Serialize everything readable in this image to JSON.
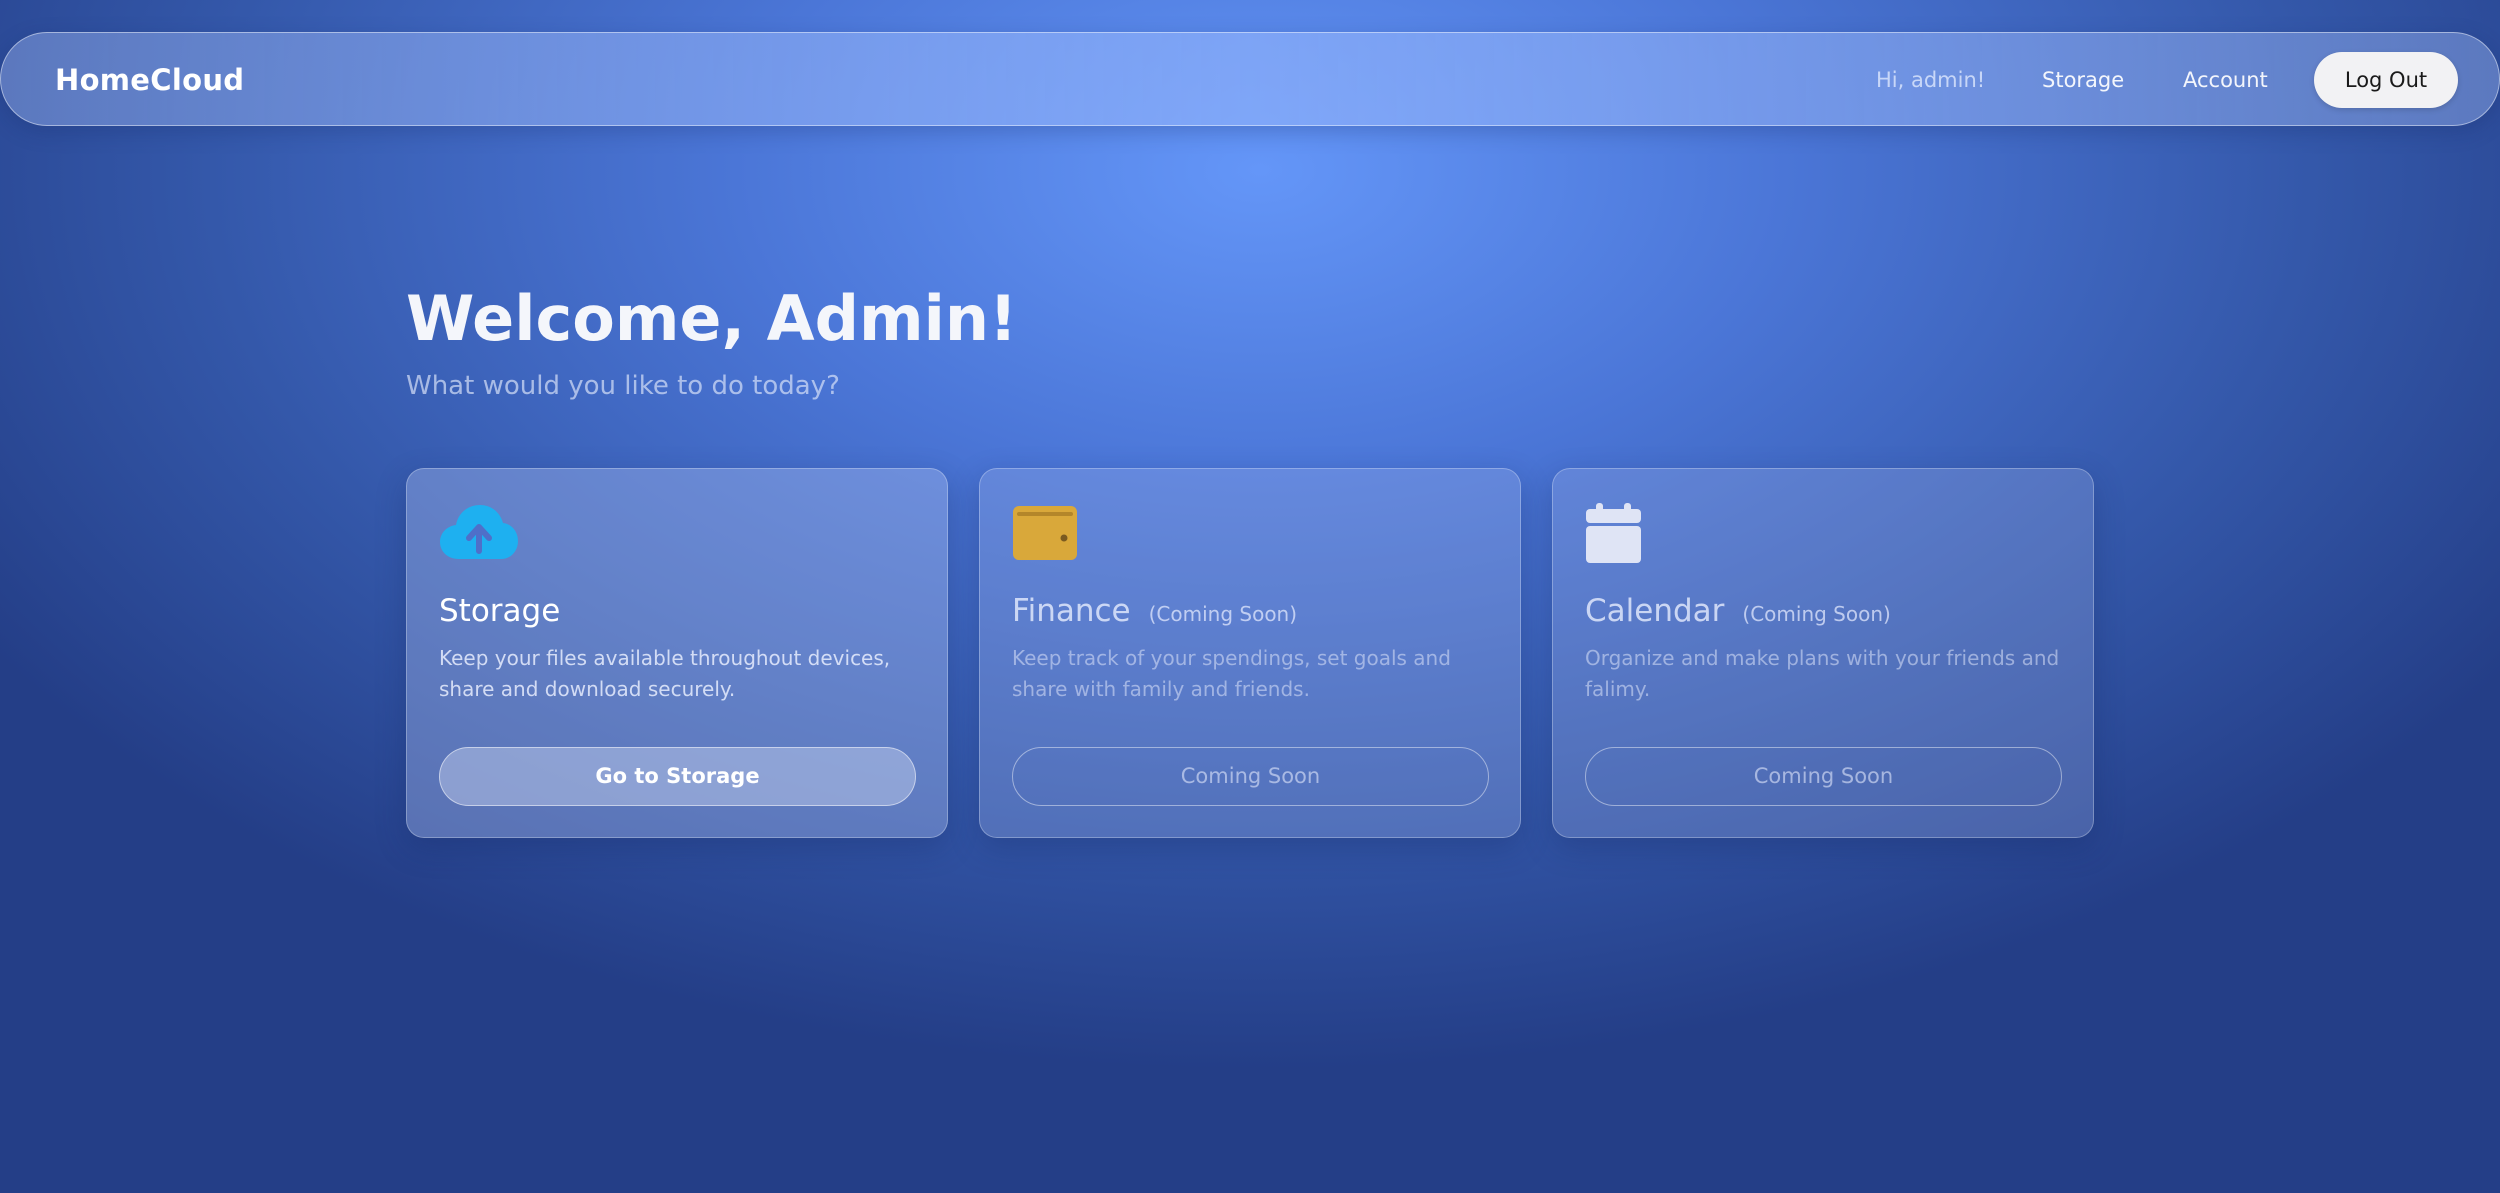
{
  "navbar": {
    "brand": "HomeCloud",
    "greeting": "Hi, admin!",
    "links": [
      {
        "label": "Storage"
      },
      {
        "label": "Account"
      }
    ],
    "logout_label": "Log Out"
  },
  "main": {
    "heading": "Welcome, Admin!",
    "subtitle": "What would you like to do today?"
  },
  "cards": [
    {
      "icon": "cloud-upload-icon",
      "icon_color": "#1eb0f0",
      "title": "Storage",
      "badge": "",
      "description": "Keep your files available throughout devices, share and download securely.",
      "button_label": "Go to Storage",
      "enabled": true
    },
    {
      "icon": "wallet-icon",
      "icon_color": "#d9a83a",
      "title": "Finance",
      "badge": "(Coming Soon)",
      "description": "Keep track of your spendings, set goals and share with family and friends.",
      "button_label": "Coming Soon",
      "enabled": false
    },
    {
      "icon": "calendar-icon",
      "icon_color": "#dfe4f5",
      "title": "Calendar",
      "badge": "(Coming Soon)",
      "description": "Organize and make plans with your friends and falimy.",
      "button_label": "Coming Soon",
      "enabled": false
    }
  ]
}
